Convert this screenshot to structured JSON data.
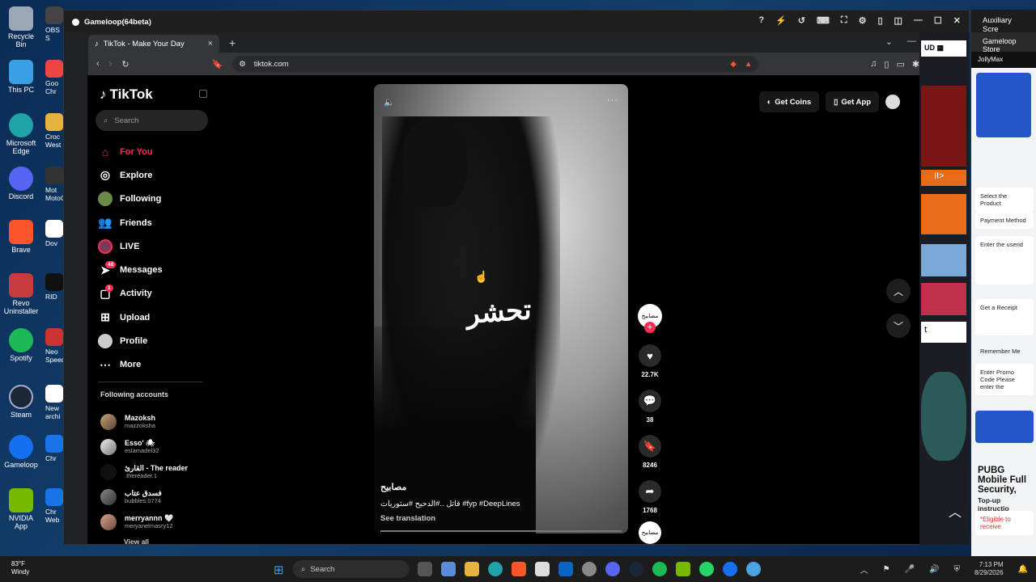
{
  "desktop": {
    "icons": [
      {
        "label": "Recycle Bin",
        "color": "#9aa7b5"
      },
      {
        "label": "This PC",
        "color": "#3aa0e6"
      },
      {
        "label": "Microsoft Edge",
        "color": "#1fa2a8"
      },
      {
        "label": "Discord",
        "color": "#5865f2"
      },
      {
        "label": "Brave",
        "color": "#fb542b"
      },
      {
        "label": "Revo Uninstaller",
        "color": "#c73b3b"
      },
      {
        "label": "Spotify",
        "color": "#1db954"
      },
      {
        "label": "Steam",
        "color": "#1b2838"
      },
      {
        "label": "Gameloop",
        "color": "#1570ef"
      },
      {
        "label": "NVIDIA App",
        "color": "#76b900"
      }
    ],
    "partial_labels": [
      "OBS S",
      "Goo Chr",
      "Croc West",
      "Mot MotoC",
      "Dov",
      "RID",
      "Neo Speed",
      "New archi",
      "Chr",
      "Chr Web"
    ]
  },
  "gameloop": {
    "title": "Gameloop(64beta)"
  },
  "browser": {
    "tab_title": "TikTok - Make Your Day",
    "url": "tiktok.com"
  },
  "tiktok": {
    "logo": "TikTok",
    "search_placeholder": "Search",
    "nav": [
      {
        "label": "For You",
        "icon": "home-icon",
        "active": true
      },
      {
        "label": "Explore",
        "icon": "compass-icon"
      },
      {
        "label": "Following",
        "icon": "following-icon"
      },
      {
        "label": "Friends",
        "icon": "friends-icon"
      },
      {
        "label": "LIVE",
        "icon": "live-icon"
      },
      {
        "label": "Messages",
        "icon": "messages-icon",
        "badge": "48"
      },
      {
        "label": "Activity",
        "icon": "activity-icon",
        "badge": "1"
      },
      {
        "label": "Upload",
        "icon": "upload-icon"
      },
      {
        "label": "Profile",
        "icon": "profile-icon"
      },
      {
        "label": "More",
        "icon": "more-icon"
      }
    ],
    "following_title": "Following accounts",
    "following": [
      {
        "name": "Mazoksh",
        "handle": "mazzoksha"
      },
      {
        "name": "Esso' 🕷",
        "handle": "eslamadel32"
      },
      {
        "name": "القارئ - The reader",
        "handle": ".thereader.1"
      },
      {
        "name": "فسدق عتاب",
        "handle": "bubbles.0774"
      },
      {
        "name": "merryannn 🤍",
        "handle": "meryanelmasry12"
      }
    ],
    "view_all": "View all",
    "video": {
      "overlay_text": "تحشر",
      "author": "مصابيح",
      "description": "قاتل ..#الدحيح #ستوريات #fyp #DeepLines",
      "see_translation": "See translation",
      "avatar_text": "مصابيح"
    },
    "actions": {
      "likes": "22.7K",
      "comments": "38",
      "saves": "8246",
      "shares": "1768"
    },
    "top_buttons": {
      "coins": "Get Coins",
      "app": "Get App"
    }
  },
  "right_panels": {
    "store_title": "Auxiliary Scre",
    "store_tab": "Gameloop Store",
    "brand": "JollyMax",
    "pubg_title": "PUBG Mobile Full Security,",
    "steps": [
      "Select the Product",
      "Payment Method",
      "Enter the userid",
      "Get a Receipt"
    ],
    "remember": "Remember Me",
    "promo": "Enter Promo Code Please enter the",
    "topup": "Top-up instructio",
    "eligible": "*Eligible to receive"
  },
  "taskbar": {
    "temp": "83°F",
    "weather": "Windy",
    "search": "Search",
    "time": "7:13 PM",
    "date": "8/29/2026"
  }
}
